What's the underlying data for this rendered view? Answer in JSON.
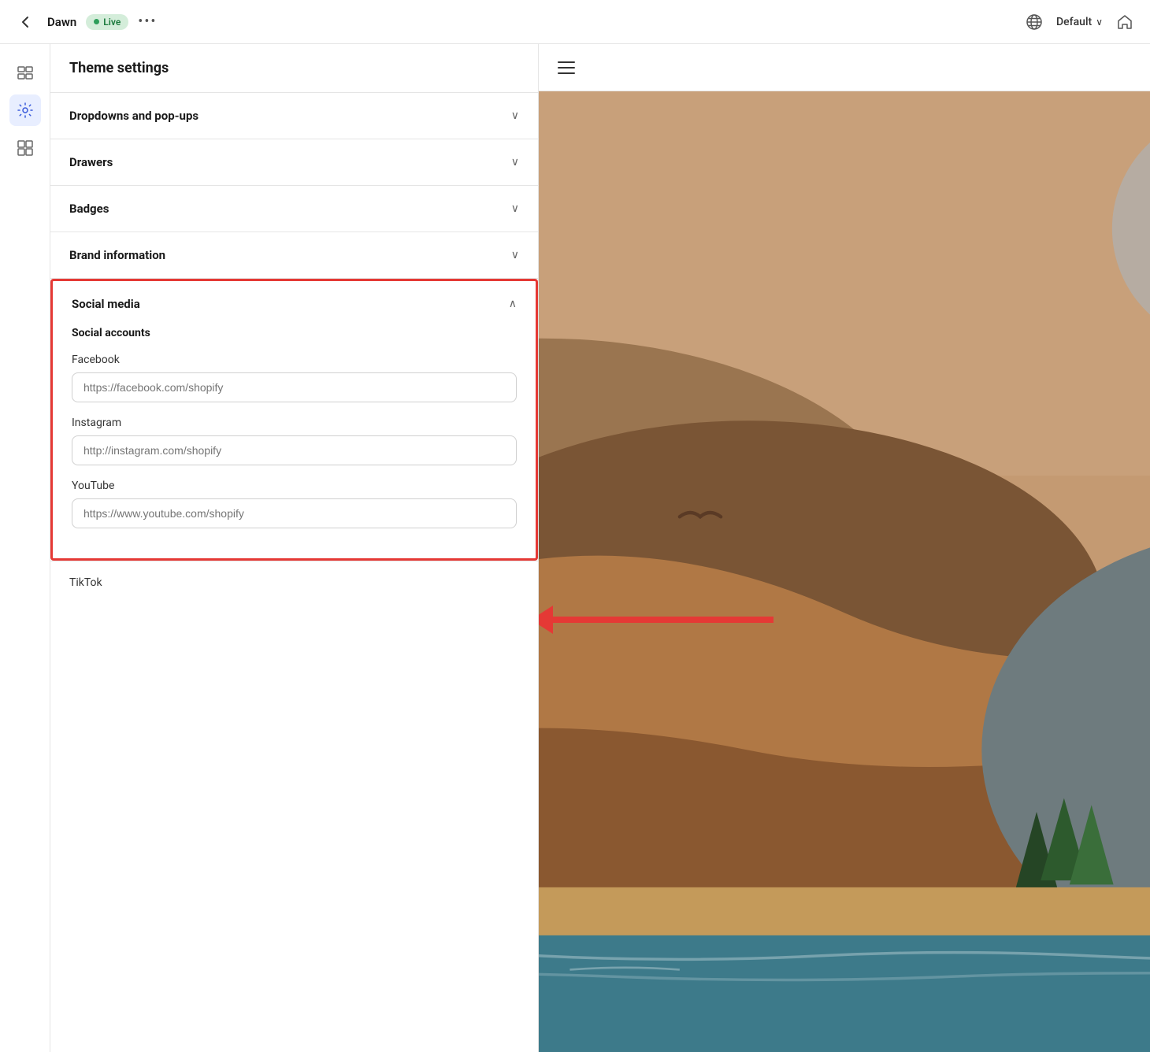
{
  "topbar": {
    "back_label": "←",
    "app_name": "Dawn",
    "live_label": "Live",
    "more_label": "•••",
    "default_label": "Default",
    "chevron": "∨",
    "home_label": "⌂"
  },
  "icon_sidebar": {
    "items": [
      {
        "icon": "⇄",
        "label": "swap-icon",
        "active": false
      },
      {
        "icon": "⚙",
        "label": "settings-icon",
        "active": true
      },
      {
        "icon": "⊞",
        "label": "grid-icon",
        "active": false
      }
    ]
  },
  "left_panel": {
    "title": "Theme settings",
    "sections": [
      {
        "id": "dropdowns",
        "label": "Dropdowns and pop-ups",
        "expanded": false
      },
      {
        "id": "drawers",
        "label": "Drawers",
        "expanded": false
      },
      {
        "id": "badges",
        "label": "Badges",
        "expanded": false
      },
      {
        "id": "brand",
        "label": "Brand information",
        "expanded": false
      }
    ],
    "social_media": {
      "label": "Social media",
      "expanded": true,
      "social_accounts_title": "Social accounts",
      "fields": [
        {
          "id": "facebook",
          "label": "Facebook",
          "placeholder": "https://facebook.com/shopify",
          "value": ""
        },
        {
          "id": "instagram",
          "label": "Instagram",
          "placeholder": "http://instagram.com/shopify",
          "value": ""
        },
        {
          "id": "youtube",
          "label": "YouTube",
          "placeholder": "https://www.youtube.com/shopify",
          "value": ""
        }
      ]
    },
    "tiktok_label": "TikTok"
  },
  "preview": {
    "hamburger_lines": 3
  },
  "colors": {
    "accent_red": "#e53935",
    "live_green": "#2d9e5a",
    "active_blue": "#3b5bdb"
  }
}
